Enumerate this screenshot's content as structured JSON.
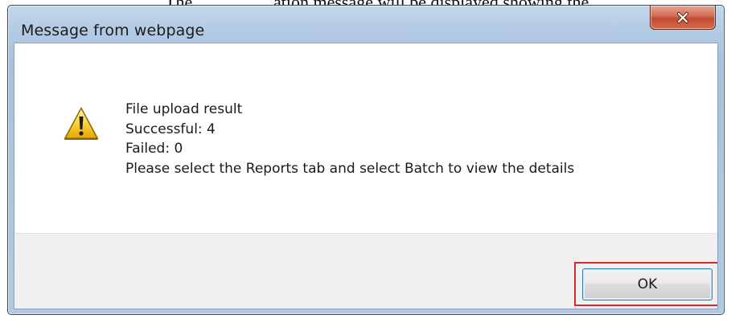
{
  "page": {
    "top_text_left": "The",
    "top_text_right": "ation message will be displayed showing the"
  },
  "dialog": {
    "title": "Message from webpage",
    "close_icon": "close-icon",
    "message_icon": "warning-icon",
    "message_lines": [
      "File upload result",
      "Successful: 4",
      "Failed: 0",
      "Please select the Reports tab and select Batch to view the details"
    ],
    "ok_label": "OK",
    "ok_highlight_color": "#d7262b",
    "close_button_color": "#c9533b"
  }
}
